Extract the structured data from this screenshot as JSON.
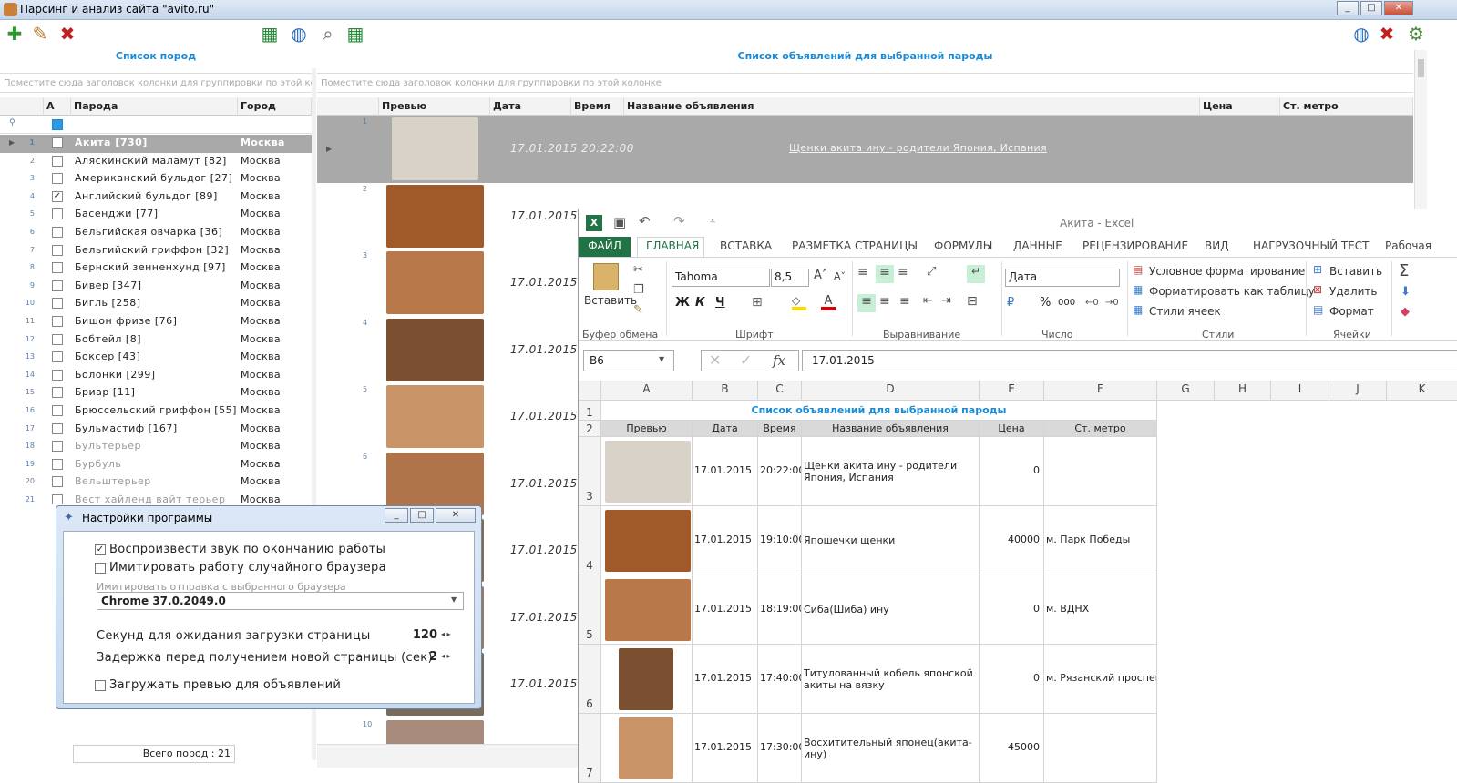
{
  "window": {
    "title": "Парсинг и анализ сайта \"avito.ru\""
  },
  "left_pane": {
    "header": "Список пород",
    "group_hint": "Поместите сюда заголовок колонки для группировки по этой колонке",
    "columns": [
      "А",
      "Парода",
      "Город"
    ],
    "rows": [
      {
        "num": "1",
        "name": "Акита   [730]",
        "city": "Москва",
        "checked": ""
      },
      {
        "num": "2",
        "name": "Аляскинский маламут   [82]",
        "city": "Москва",
        "checked": ""
      },
      {
        "num": "3",
        "name": "Американский бульдог   [27]",
        "city": "Москва",
        "checked": ""
      },
      {
        "num": "4",
        "name": "Английский бульдог   [89]",
        "city": "Москва",
        "checked": "✓"
      },
      {
        "num": "5",
        "name": "Басенджи   [77]",
        "city": "Москва",
        "checked": ""
      },
      {
        "num": "6",
        "name": "Бельгийская овчарка   [36]",
        "city": "Москва",
        "checked": ""
      },
      {
        "num": "7",
        "name": "Бельгийский гриффон   [32]",
        "city": "Москва",
        "checked": ""
      },
      {
        "num": "8",
        "name": "Бернский зенненхунд   [97]",
        "city": "Москва",
        "checked": ""
      },
      {
        "num": "9",
        "name": "Бивер   [347]",
        "city": "Москва",
        "checked": ""
      },
      {
        "num": "10",
        "name": "Бигль   [258]",
        "city": "Москва",
        "checked": ""
      },
      {
        "num": "11",
        "name": "Бишон фризе   [76]",
        "city": "Москва",
        "checked": ""
      },
      {
        "num": "12",
        "name": "Бобтейл   [8]",
        "city": "Москва",
        "checked": ""
      },
      {
        "num": "13",
        "name": "Боксер   [43]",
        "city": "Москва",
        "checked": ""
      },
      {
        "num": "14",
        "name": "Болонки   [299]",
        "city": "Москва",
        "checked": ""
      },
      {
        "num": "15",
        "name": "Бриар   [11]",
        "city": "Москва",
        "checked": ""
      },
      {
        "num": "16",
        "name": "Брюссельский гриффон   [55]",
        "city": "Москва",
        "checked": ""
      },
      {
        "num": "17",
        "name": "Бульмастиф   [167]",
        "city": "Москва",
        "checked": ""
      },
      {
        "num": "18",
        "name": "Бультерьер",
        "city": "Москва",
        "checked": ""
      },
      {
        "num": "19",
        "name": "Бурбуль",
        "city": "Москва",
        "checked": ""
      },
      {
        "num": "20",
        "name": "Вельштерьер",
        "city": "Москва",
        "checked": ""
      },
      {
        "num": "21",
        "name": "Вест хайленд вайт терьер",
        "city": "Москва",
        "checked": ""
      }
    ],
    "footer": "Всего пород : 21"
  },
  "right_pane": {
    "header": "Список объявлений для выбранной пароды",
    "group_hint": "Поместите сюда заголовок колонки для группировки по этой колонке",
    "columns": [
      "Превью",
      "Дата",
      "Время",
      "Название объявления",
      "Цена",
      "Ст. метро"
    ],
    "rows": [
      {
        "num": "1",
        "date": "17.01.2015  20:22:00",
        "title": "Щенки акита ину - родители Япония, Испания"
      },
      {
        "num": "2",
        "date": "17.01.2015  1"
      },
      {
        "num": "3",
        "date": "17.01.2015  1"
      },
      {
        "num": "4",
        "date": "17.01.2015  1"
      },
      {
        "num": "5",
        "date": "17.01.2015  1"
      },
      {
        "num": "6",
        "date": "17.01.2015  1"
      },
      {
        "num": "",
        "date": "17.01.2015  1"
      },
      {
        "num": "",
        "date": "17.01.2015  1"
      },
      {
        "num": "",
        "date": "17.01.2015  1"
      },
      {
        "num": "10",
        "date": ""
      }
    ]
  },
  "settings_dialog": {
    "title": "Настройки программы",
    "opt_sound": "Воспроизвести звук по окончанию работы",
    "opt_sound_checked": "✓",
    "opt_random_browser": "Имитировать работу случайного браузера",
    "browser_label": "Имитировать отправка с выбранного браузера",
    "browser_value": "Chrome 37.0.2049.0",
    "wait_label": "Секунд для ожидания загрузки страницы",
    "wait_value": "120",
    "delay_label": "Задержка перед получением новой страницы (сек)",
    "delay_value": "2",
    "opt_previews": "Загружать превью для объявлений"
  },
  "excel": {
    "title": "Акита - Excel",
    "file_tab": "ФАЙЛ",
    "tabs": [
      "ГЛАВНАЯ",
      "ВСТАВКА",
      "РАЗМЕТКА СТРАНИЦЫ",
      "ФОРМУЛЫ",
      "ДАННЫЕ",
      "РЕЦЕНЗИРОВАНИЕ",
      "ВИД",
      "НАГРУЗОЧНЫЙ ТЕСТ",
      "Рабочая"
    ],
    "ribbon": {
      "paste": "Вставить",
      "clipboard": "Буфер обмена",
      "font_name": "Tahoma",
      "font_size": "8,5",
      "bold": "Ж",
      "italic": "К",
      "underline": "Ч",
      "font_group": "Шрифт",
      "align_group": "Выравнивание",
      "number_format": "Дата",
      "percent": "%",
      "thousands": "000",
      "number_group": "Число",
      "cond_format": "Условное форматирование",
      "format_table": "Форматировать как таблицу",
      "cell_styles": "Стили ячеек",
      "styles_group": "Стили",
      "insert": "Вставить",
      "delete": "Удалить",
      "format": "Формат",
      "cells_group": "Ячейки"
    },
    "name_box": "B6",
    "fx": "fx",
    "formula": "17.01.2015",
    "col_letters": [
      "A",
      "B",
      "C",
      "D",
      "E",
      "F",
      "G",
      "H",
      "I",
      "J",
      "K"
    ],
    "sheet_title": "Список объявлений для выбранной пароды",
    "headers": [
      "Превью",
      "Дата",
      "Время",
      "Название объявления",
      "Цена",
      "Ст. метро"
    ],
    "rows": [
      {
        "row": "3",
        "date": "17.01.2015",
        "time": "20:22:00",
        "title": "Щенки акита ину - родители Япония, Испания",
        "price": "0",
        "metro": ""
      },
      {
        "row": "4",
        "date": "17.01.2015",
        "time": "19:10:00",
        "title": "Япошечки щенки",
        "price": "40000",
        "metro": "м. Парк Победы"
      },
      {
        "row": "5",
        "date": "17.01.2015",
        "time": "18:19:00",
        "title": "Сиба(Шиба) ину",
        "price": "0",
        "metro": "м. ВДНХ"
      },
      {
        "row": "6",
        "date": "17.01.2015",
        "time": "17:40:00",
        "title": "Титулованный кобель японской акиты на вязку",
        "price": "0",
        "metro": "м. Рязанский проспект"
      },
      {
        "row": "7",
        "date": "17.01.2015",
        "time": "17:30:00",
        "title": "Восхитительный японец(акита-ину)",
        "price": "45000",
        "metro": ""
      }
    ]
  }
}
